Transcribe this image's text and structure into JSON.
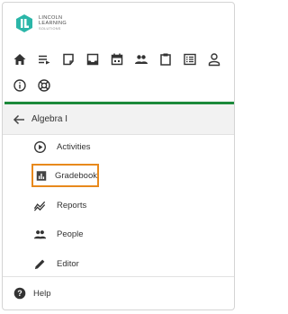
{
  "logo": {
    "line1": "LINCOLN",
    "line2": "LEARNING",
    "line3": "SOLUTIONS",
    "accent": "#2bb6a8"
  },
  "toolbar": {
    "row1": [
      {
        "name": "home-icon"
      },
      {
        "name": "list-arrow-icon"
      },
      {
        "name": "note-icon"
      },
      {
        "name": "inbox-icon"
      },
      {
        "name": "calendar-icon"
      },
      {
        "name": "people-icon"
      },
      {
        "name": "clipboard-icon"
      },
      {
        "name": "checklist-icon"
      },
      {
        "name": "person-icon"
      }
    ],
    "row2": [
      {
        "name": "info-icon"
      },
      {
        "name": "lifebuoy-icon"
      }
    ],
    "rule_color": "#1c8a3b"
  },
  "course": {
    "title": "Algebra I"
  },
  "nav": {
    "items": [
      {
        "label": "Activities",
        "icon": "play-circle-icon"
      },
      {
        "label": "Gradebook",
        "icon": "gradebook-icon",
        "highlighted": true
      },
      {
        "label": "Reports",
        "icon": "reports-icon"
      },
      {
        "label": "People",
        "icon": "people-icon"
      },
      {
        "label": "Editor",
        "icon": "pencil-icon"
      }
    ],
    "highlight_color": "#e8891c"
  },
  "footer": {
    "help_label": "Help"
  }
}
